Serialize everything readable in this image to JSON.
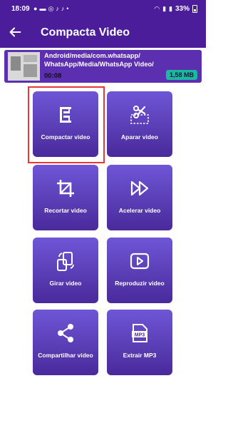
{
  "status": {
    "time": "18:09",
    "battery": "33%"
  },
  "appbar": {
    "title": "Compacta Video"
  },
  "file": {
    "path": "Android/media/com.whatsapp/\nWhatsApp/Media/WhatsApp Video/",
    "duration": "00:08",
    "size": "1,58 MB"
  },
  "tools": [
    {
      "label": "Compactar video",
      "icon": "compress-clamp-icon"
    },
    {
      "label": "Aparar video",
      "icon": "scissors-icon"
    },
    {
      "label": "Recortar video",
      "icon": "crop-icon"
    },
    {
      "label": "Acelerar video",
      "icon": "fast-forward-icon"
    },
    {
      "label": "Girar video",
      "icon": "rotate-device-icon"
    },
    {
      "label": "Reproduzir video",
      "icon": "play-icon"
    },
    {
      "label": "Compartilhar video",
      "icon": "share-icon"
    },
    {
      "label": "Extrair MP3",
      "icon": "mp3-file-icon"
    }
  ],
  "colors": {
    "primary": "#4c1d9a",
    "tile_top": "#6e56d6",
    "tile_bottom": "#4a2a9b",
    "size_badge": "#1bb8a0",
    "highlight": "#e53935"
  }
}
